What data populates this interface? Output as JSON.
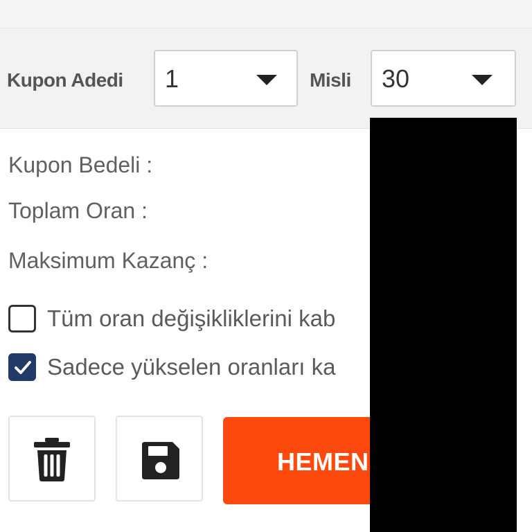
{
  "options": {
    "coupon_count_label": "Kupon Adedi",
    "coupon_count_value": "1",
    "multiplier_label": "Misli",
    "multiplier_value": "30"
  },
  "summary": {
    "coupon_price_label": "Kupon Bedeli :",
    "total_odds_label": "Toplam Oran :",
    "max_win_label": "Maksimum Kazanç :"
  },
  "checkboxes": [
    {
      "label": "Tüm oran değişikliklerini kab",
      "checked": false
    },
    {
      "label": "Sadece yükselen oranları ka",
      "checked": true
    }
  ],
  "actions": {
    "delete_icon": "trash-icon",
    "save_icon": "floppy-disk-icon",
    "play_label": "HEMEN"
  },
  "colors": {
    "accent": "#fc4a0e",
    "checkbox_checked": "#243a66",
    "redaction": "#000000"
  }
}
